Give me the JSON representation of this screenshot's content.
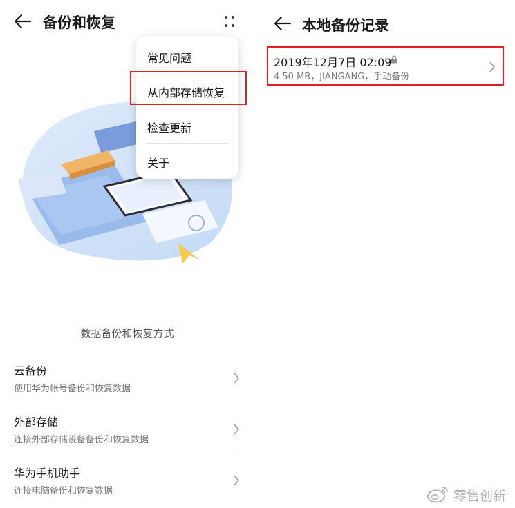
{
  "left_screen": {
    "title": "备份和恢复",
    "menu": {
      "items": [
        {
          "label": "常见问题"
        },
        {
          "label": "从内部存储恢复",
          "highlighted": true
        },
        {
          "label": "检查更新"
        },
        {
          "label": "关于"
        }
      ]
    },
    "section_caption": "数据备份和恢复方式",
    "options": [
      {
        "title": "云备份",
        "subtitle": "使用华为帐号备份和恢复数据"
      },
      {
        "title": "外部存储",
        "subtitle": "连接外部存储设备备份和恢复数据"
      },
      {
        "title": "华为手机助手",
        "subtitle": "连接电脑备份和恢复数据"
      }
    ]
  },
  "right_screen": {
    "title": "本地备份记录",
    "records": [
      {
        "date": "2019年12月7日 02:09",
        "details": "4.50 MB，JIANGANG，手动备份",
        "locked": true,
        "highlighted": true
      }
    ]
  },
  "watermark": {
    "text": "零售创新"
  },
  "colors": {
    "highlight_border": "#e02020",
    "illustration_blue": "#bcd6f5",
    "text_primary": "#1a1a1a",
    "text_secondary": "#7a7a7a"
  },
  "icons": [
    "back-arrow-icon",
    "more-vertical-icon",
    "chevron-right-icon",
    "lock-icon",
    "weibo-icon"
  ]
}
